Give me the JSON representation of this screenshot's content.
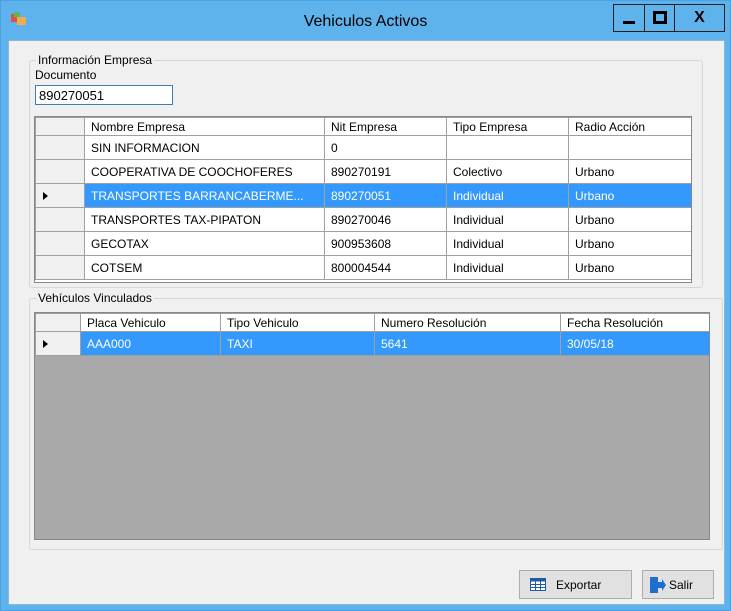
{
  "window": {
    "title": "Vehiculos Activos",
    "min_label": "_",
    "close_label": "X"
  },
  "empresa": {
    "legend": "Información Empresa",
    "documento_label": "Documento",
    "documento_value": "890270051",
    "columns": [
      "Nombre Empresa",
      "Nit Empresa",
      "Tipo Empresa",
      "Radio Acción"
    ],
    "rows": [
      [
        "SIN INFORMACION",
        "0",
        "",
        ""
      ],
      [
        "COOPERATIVA DE COOCHOFERES",
        "890270191",
        "Colectivo",
        "Urbano"
      ],
      [
        "TRANSPORTES BARRANCABERME...",
        "890270051",
        "Individual",
        "Urbano"
      ],
      [
        "TRANSPORTES TAX-PIPATON",
        "890270046",
        "Individual",
        "Urbano"
      ],
      [
        "GECOTAX",
        "900953608",
        "Individual",
        "Urbano"
      ],
      [
        "COTSEM",
        "800004544",
        "Individual",
        "Urbano"
      ]
    ],
    "selected_row": 2
  },
  "vehiculos": {
    "legend": "Vehículos Vinculados",
    "columns": [
      "Placa Vehiculo",
      "Tipo Vehiculo",
      "Numero Resolución",
      "Fecha Resolución"
    ],
    "rows": [
      [
        "AAA000",
        "TAXI",
        "5641",
        "30/05/18"
      ]
    ],
    "selected_row": 0
  },
  "buttons": {
    "export_label": "Exportar",
    "exit_label": "Salir"
  },
  "colors": {
    "titlebar": "#5fb3ec",
    "selection": "#3399ff",
    "empty_grid": "#a9a9a9"
  }
}
